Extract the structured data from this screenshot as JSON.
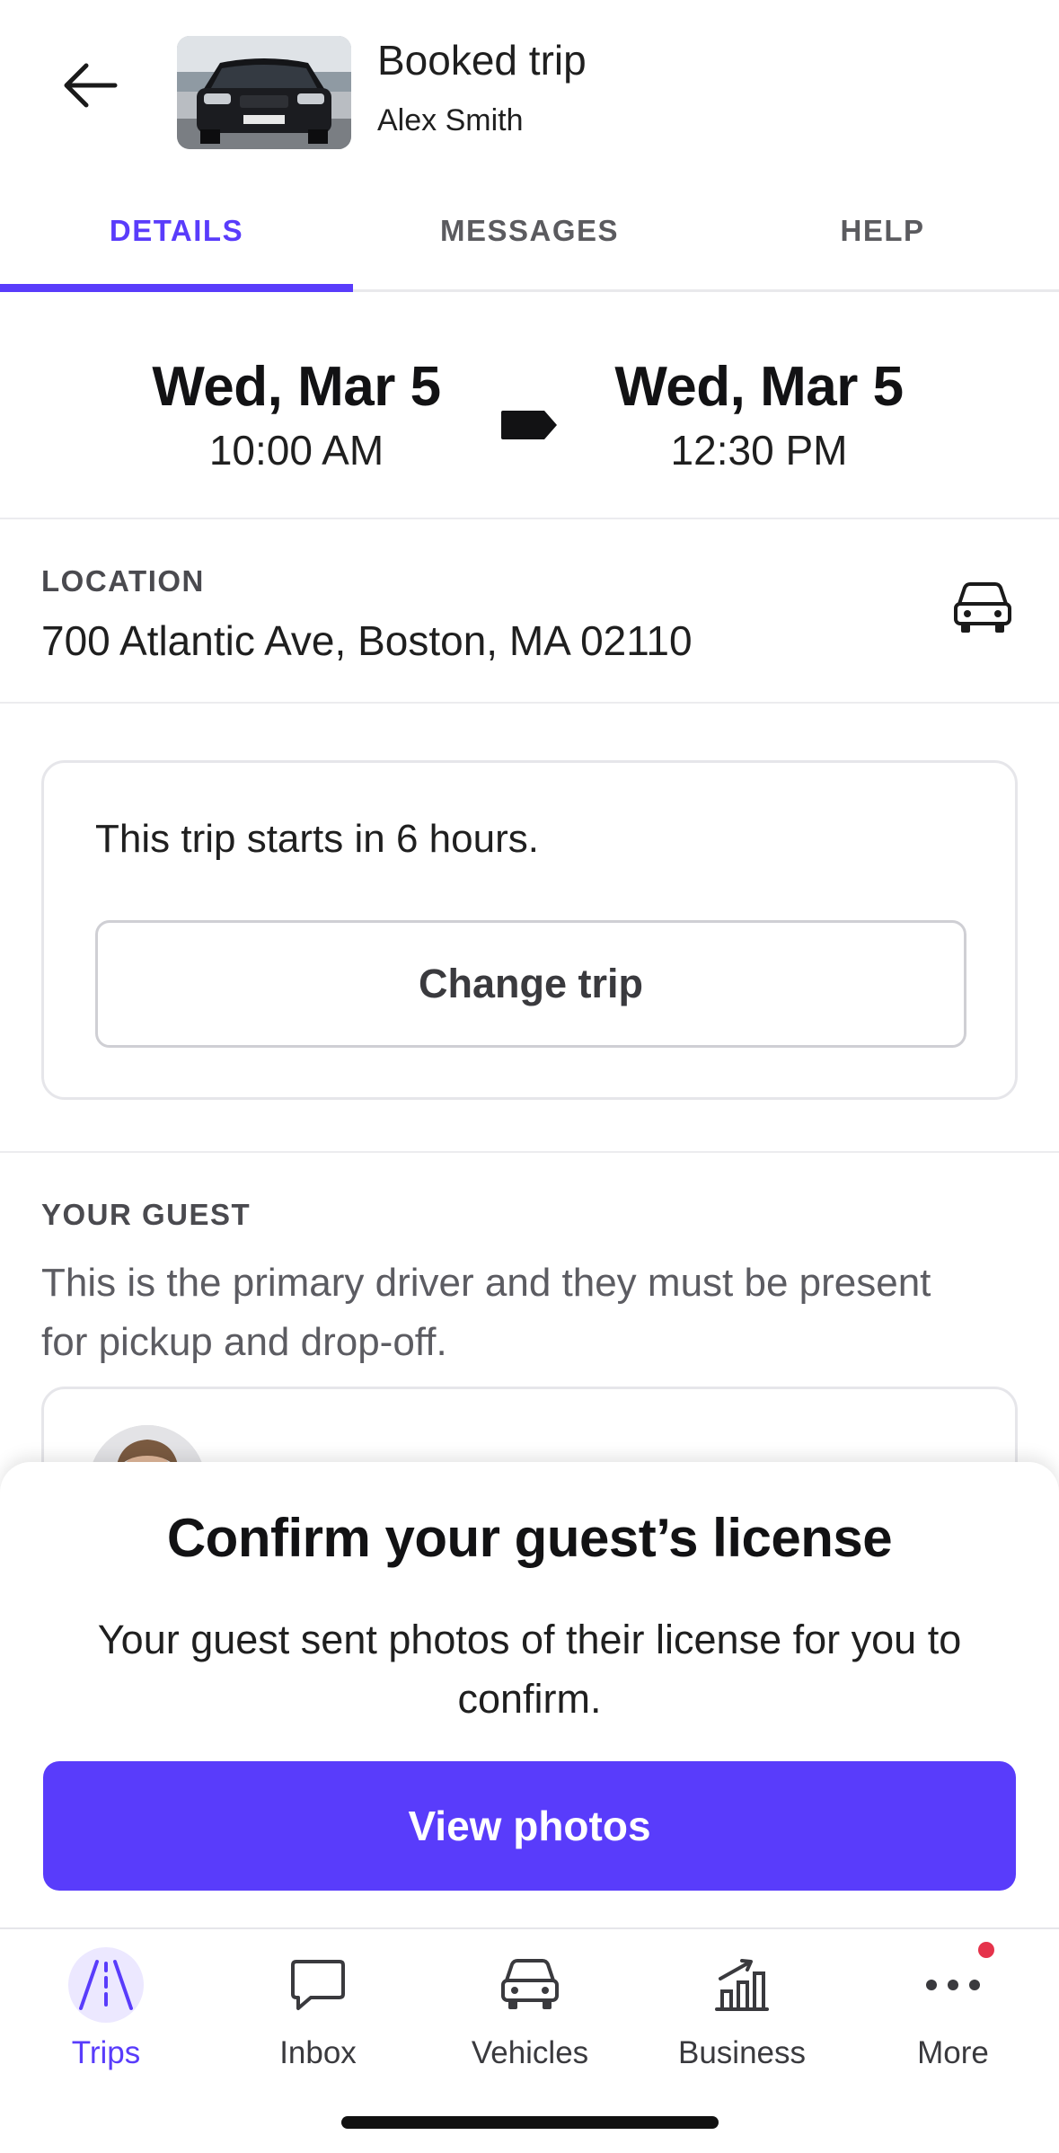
{
  "header": {
    "title": "Booked trip",
    "host_name": "Alex Smith"
  },
  "tabs": [
    {
      "label": "DETAILS",
      "active": true
    },
    {
      "label": "MESSAGES",
      "active": false
    },
    {
      "label": "HELP",
      "active": false
    }
  ],
  "trip": {
    "start_day": "Wed, Mar 5",
    "start_time": "10:00 AM",
    "end_day": "Wed, Mar 5",
    "end_time": "12:30 PM"
  },
  "location": {
    "label": "LOCATION",
    "address": "700 Atlantic Ave, Boston, MA 02110"
  },
  "trip_card": {
    "notice": "This trip starts in 6 hours.",
    "change_button": "Change trip"
  },
  "guest": {
    "label": "YOUR GUEST",
    "description": "This is the primary driver and they must be present for pickup and drop-off."
  },
  "sheet": {
    "title": "Confirm your guest’s license",
    "text": "Your guest sent photos of their license for you to confirm.",
    "button": "View photos"
  },
  "nav": [
    {
      "label": "Trips",
      "icon": "trips-road-icon",
      "active": true
    },
    {
      "label": "Inbox",
      "icon": "inbox-chat-icon",
      "active": false
    },
    {
      "label": "Vehicles",
      "icon": "car-icon",
      "active": false
    },
    {
      "label": "Business",
      "icon": "chart-icon",
      "active": false
    },
    {
      "label": "More",
      "icon": "more-dots-icon",
      "active": false,
      "badge": true
    }
  ],
  "colors": {
    "accent": "#593cfb",
    "badge": "#e5334b"
  }
}
